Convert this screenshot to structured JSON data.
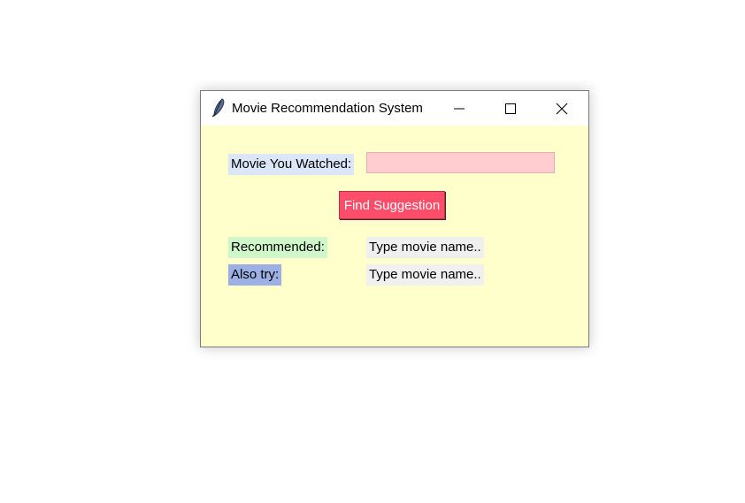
{
  "window": {
    "title": "Movie Recommendation System"
  },
  "form": {
    "movie_label": "Movie You Watched:",
    "movie_value": "",
    "find_button": "Find Suggestion",
    "recommended_label": "Recommended:",
    "recommended_value": "Type movie name..",
    "also_try_label": "Also try:",
    "also_try_value": "Type movie name.."
  },
  "colors": {
    "window_bg": "#ffffcc",
    "entry_bg": "#ffcdd0",
    "button_bg": "#ff4d6a",
    "movie_label_bg": "#dbe6f8",
    "recommended_label_bg": "#d0f7c9",
    "also_try_label_bg": "#9cb0e6"
  },
  "icons": [
    "feather-icon",
    "minimize-icon",
    "maximize-icon",
    "close-icon"
  ]
}
